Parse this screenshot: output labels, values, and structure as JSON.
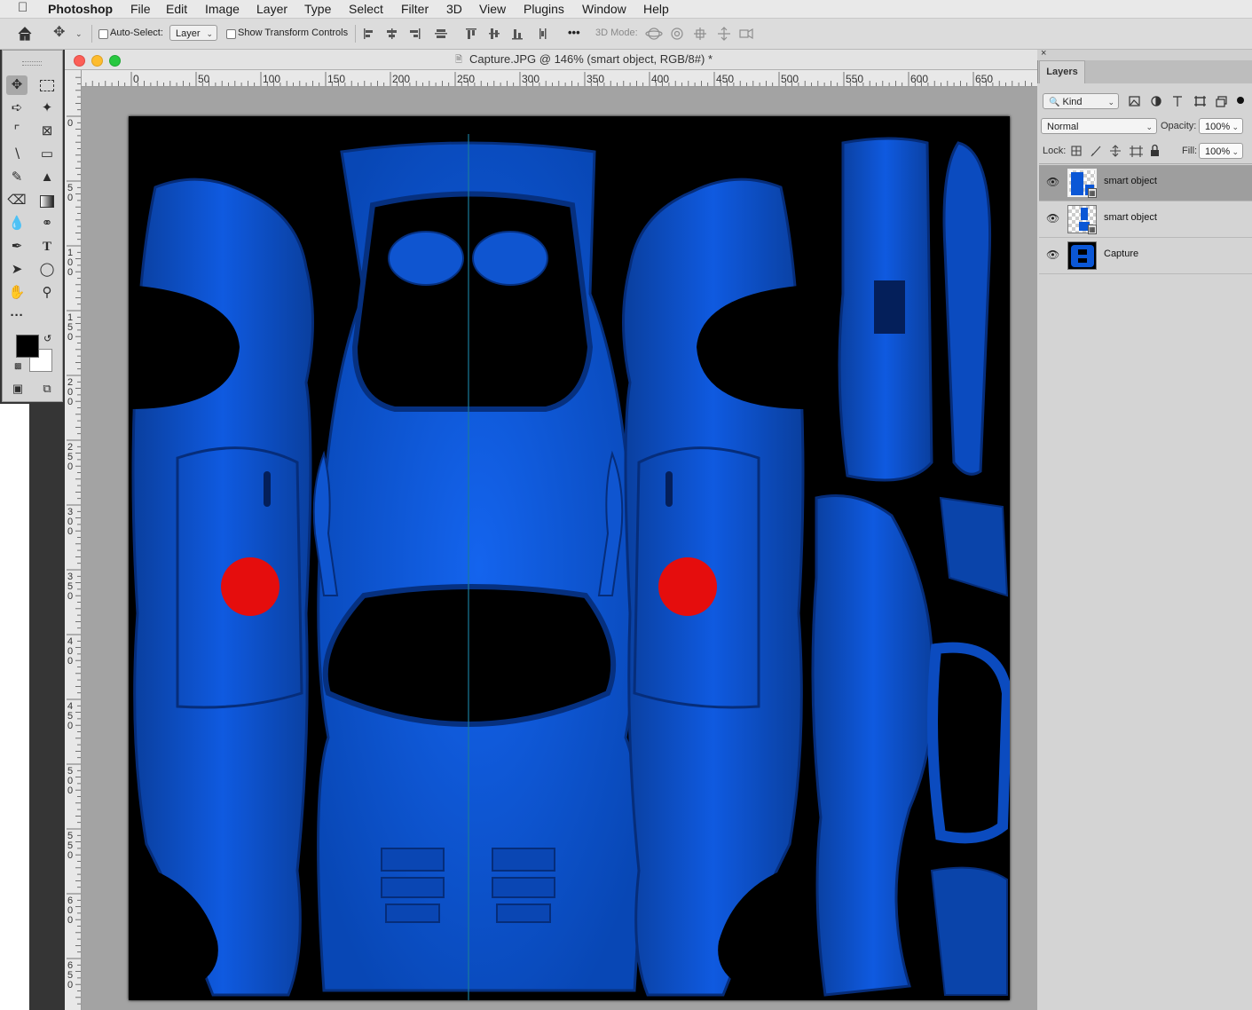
{
  "menubar": {
    "apple": "",
    "app": "Photoshop",
    "items": [
      "File",
      "Edit",
      "Image",
      "Layer",
      "Type",
      "Select",
      "Filter",
      "3D",
      "View",
      "Plugins",
      "Window",
      "Help"
    ]
  },
  "options": {
    "auto_select_label": "Auto-Select:",
    "auto_select_value": "Layer",
    "show_transform_label": "Show Transform Controls",
    "more": "•••",
    "mode_3d_label": "3D Mode:"
  },
  "document": {
    "title": "Capture.JPG @ 146% (smart object, RGB/8#) *",
    "h_ruler": [
      "0",
      "50",
      "100",
      "150",
      "200",
      "250",
      "300",
      "350",
      "400",
      "450",
      "500",
      "550",
      "600",
      "650"
    ],
    "v_ruler": [
      [
        "0"
      ],
      [
        "5",
        "0"
      ],
      [
        "1",
        "0",
        "0"
      ],
      [
        "1",
        "5",
        "0"
      ],
      [
        "2",
        "0",
        "0"
      ],
      [
        "2",
        "5",
        "0"
      ],
      [
        "3",
        "0",
        "0"
      ],
      [
        "3",
        "5",
        "0"
      ],
      [
        "4",
        "0",
        "0"
      ],
      [
        "4",
        "5",
        "0"
      ],
      [
        "5",
        "0",
        "0"
      ],
      [
        "5",
        "5",
        "0"
      ],
      [
        "6",
        "0",
        "0"
      ],
      [
        "6",
        "5",
        "0"
      ]
    ]
  },
  "colors": {
    "body_blue": "#0b57d6",
    "marker_red": "#e50d0d",
    "foreground": "#000000",
    "background": "#ffffff"
  },
  "layers_panel": {
    "tab": "Layers",
    "filter_kind": "Kind",
    "blend_mode": "Normal",
    "opacity_label": "Opacity:",
    "opacity_value": "100%",
    "lock_label": "Lock:",
    "fill_label": "Fill:",
    "fill_value": "100%",
    "layers": [
      {
        "name": "smart object",
        "selected": true
      },
      {
        "name": "smart object",
        "selected": false
      },
      {
        "name": "Capture",
        "selected": false
      }
    ]
  }
}
